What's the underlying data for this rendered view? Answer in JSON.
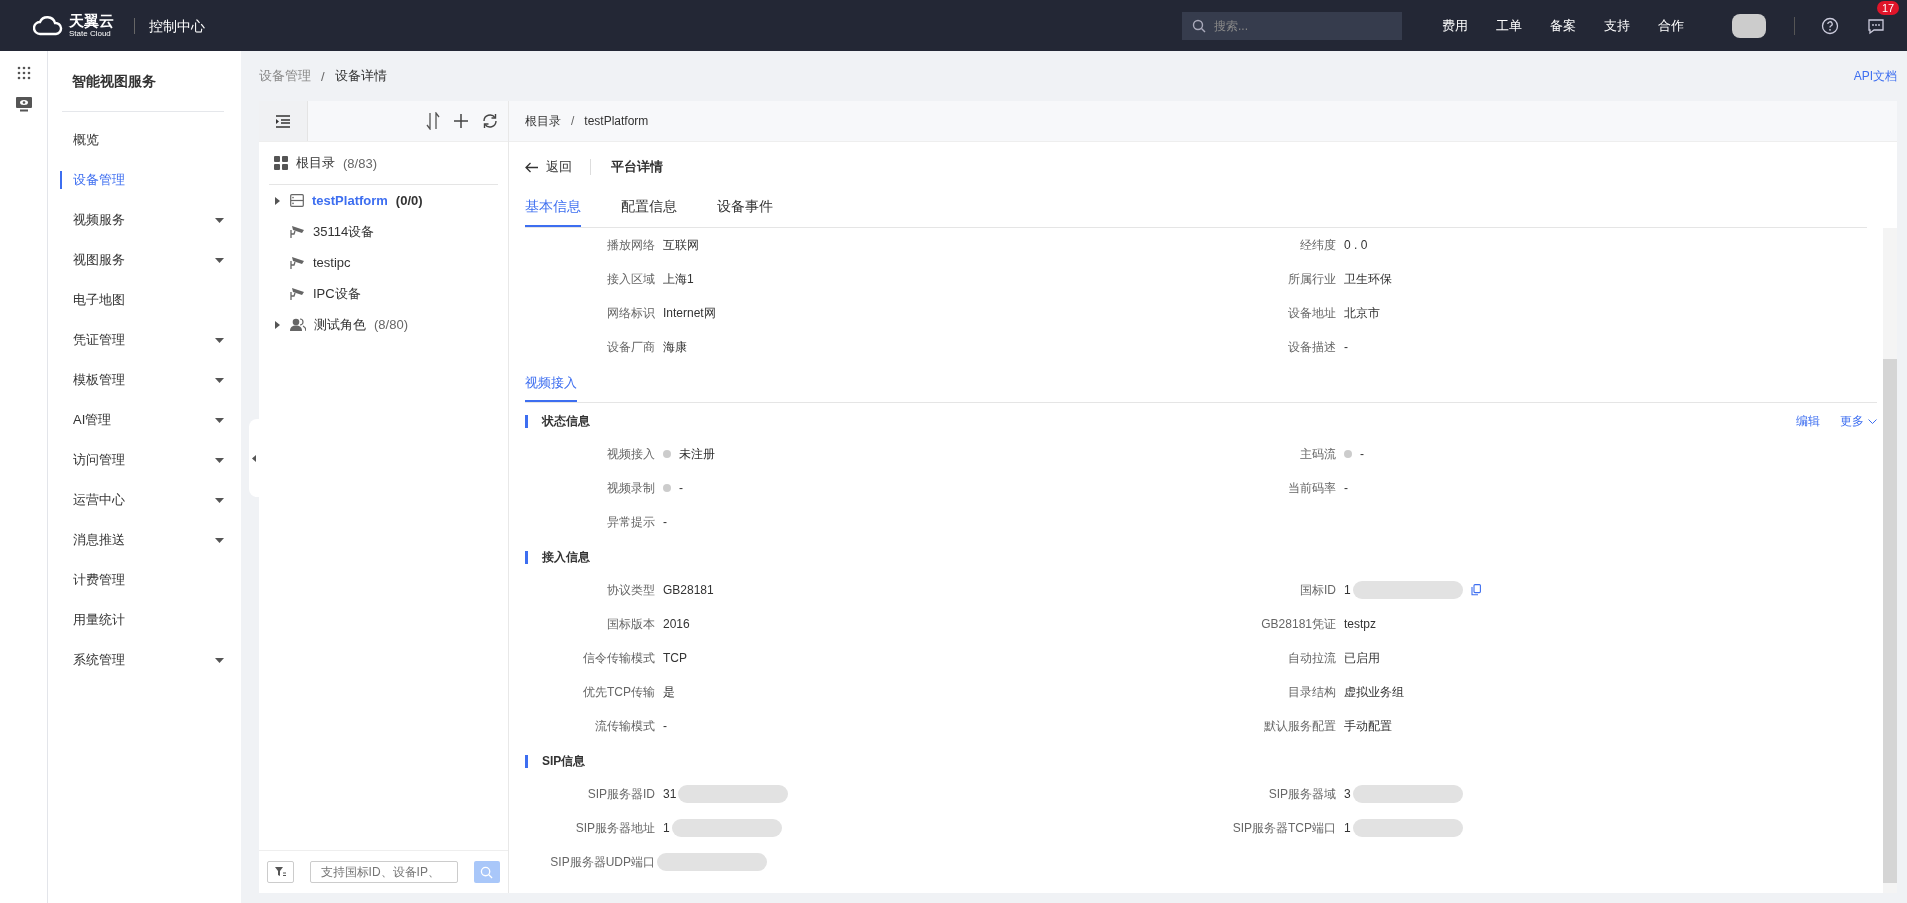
{
  "topbar": {
    "logo_text": "天翼云",
    "logo_sub": "State Cloud",
    "console": "控制中心",
    "search_placeholder": "搜索...",
    "links": [
      "费用",
      "工单",
      "备案",
      "支持",
      "合作"
    ],
    "notification_count": "17"
  },
  "sidebar": {
    "title": "智能视图服务",
    "items": [
      {
        "label": "概览",
        "selected": false,
        "has_submenu": false
      },
      {
        "label": "设备管理",
        "selected": true,
        "has_submenu": false
      },
      {
        "label": "视频服务",
        "selected": false,
        "has_submenu": true
      },
      {
        "label": "视图服务",
        "selected": false,
        "has_submenu": true
      },
      {
        "label": "电子地图",
        "selected": false,
        "has_submenu": false
      },
      {
        "label": "凭证管理",
        "selected": false,
        "has_submenu": true
      },
      {
        "label": "模板管理",
        "selected": false,
        "has_submenu": true
      },
      {
        "label": "AI管理",
        "selected": false,
        "has_submenu": true
      },
      {
        "label": "访问管理",
        "selected": false,
        "has_submenu": true
      },
      {
        "label": "运营中心",
        "selected": false,
        "has_submenu": true
      },
      {
        "label": "消息推送",
        "selected": false,
        "has_submenu": true
      },
      {
        "label": "计费管理",
        "selected": false,
        "has_submenu": false
      },
      {
        "label": "用量统计",
        "selected": false,
        "has_submenu": false
      },
      {
        "label": "系统管理",
        "selected": false,
        "has_submenu": true
      }
    ]
  },
  "breadcrumb": [
    "设备管理",
    "设备详情"
  ],
  "separator": "/",
  "api_link": "API文档",
  "tree": {
    "root": {
      "label": "根目录",
      "count": "(8/83)"
    },
    "items": [
      {
        "kind": "platform",
        "label": "testPlatform",
        "count": "(0/0)",
        "selected": true,
        "expandable": true
      },
      {
        "kind": "camera",
        "label": "35114设备",
        "selected": false,
        "expandable": false
      },
      {
        "kind": "camera",
        "label": "testipc",
        "selected": false,
        "expandable": false
      },
      {
        "kind": "camera",
        "label": "IPC设备",
        "selected": false,
        "expandable": false
      },
      {
        "kind": "group",
        "label": "测试角色",
        "count": "(8/80)",
        "selected": false,
        "expandable": true
      }
    ],
    "search_placeholder": "支持国标ID、设备IP、"
  },
  "detail": {
    "path": [
      "根目录",
      "testPlatform"
    ],
    "back": "返回",
    "title": "平台详情",
    "tabs": [
      {
        "label": "基本信息",
        "selected": true
      },
      {
        "label": "配置信息",
        "selected": false
      },
      {
        "label": "设备事件",
        "selected": false
      }
    ],
    "basic_rows": [
      [
        {
          "label": "播放网络",
          "value": "互联网"
        },
        {
          "label": "经纬度",
          "value": "0 . 0"
        }
      ],
      [
        {
          "label": "接入区域",
          "value": "上海1"
        },
        {
          "label": "所属行业",
          "value": "卫生环保"
        }
      ],
      [
        {
          "label": "网络标识",
          "value": "Internet网"
        },
        {
          "label": "设备地址",
          "value": "北京市"
        }
      ],
      [
        {
          "label": "设备厂商",
          "value": "海康"
        },
        {
          "label": "设备描述",
          "value": "-"
        }
      ]
    ],
    "sub_tab": "视频接入",
    "edit": "编辑",
    "more": "更多",
    "sections": [
      {
        "title": "状态信息",
        "rows": [
          [
            {
              "label": "视频接入",
              "value": "未注册",
              "dot": true
            },
            {
              "label": "主码流",
              "value": "-",
              "dot": true
            }
          ],
          [
            {
              "label": "视频录制",
              "value": "-",
              "dot": true
            },
            {
              "label": "当前码率",
              "value": "-"
            }
          ],
          [
            {
              "label": "异常提示",
              "value": "-"
            }
          ]
        ]
      },
      {
        "title": "接入信息",
        "rows": [
          [
            {
              "label": "协议类型",
              "value": "GB28181"
            },
            {
              "label": "国标ID",
              "value": "1",
              "blurred": true,
              "copy": true
            }
          ],
          [
            {
              "label": "国标版本",
              "value": "2016"
            },
            {
              "label": "GB28181凭证",
              "value": "testpz"
            }
          ],
          [
            {
              "label": "信令传输模式",
              "value": "TCP"
            },
            {
              "label": "自动拉流",
              "value": "已启用"
            }
          ],
          [
            {
              "label": "优先TCP传输",
              "value": "是"
            },
            {
              "label": "目录结构",
              "value": "虚拟业务组"
            }
          ],
          [
            {
              "label": "流传输模式",
              "value": "-"
            },
            {
              "label": "默认服务配置",
              "value": "手动配置"
            }
          ]
        ]
      },
      {
        "title": "SIP信息",
        "rows": [
          [
            {
              "label": "SIP服务器ID",
              "value": "31",
              "blurred": true
            },
            {
              "label": "SIP服务器域",
              "value": "3",
              "blurred": true
            }
          ],
          [
            {
              "label": "SIP服务器地址",
              "value": "1",
              "blurred": true
            },
            {
              "label": "SIP服务器TCP端口",
              "value": "1",
              "blurred": true
            }
          ],
          [
            {
              "label": "SIP服务器UDP端口",
              "blurred": true
            }
          ]
        ]
      }
    ]
  }
}
